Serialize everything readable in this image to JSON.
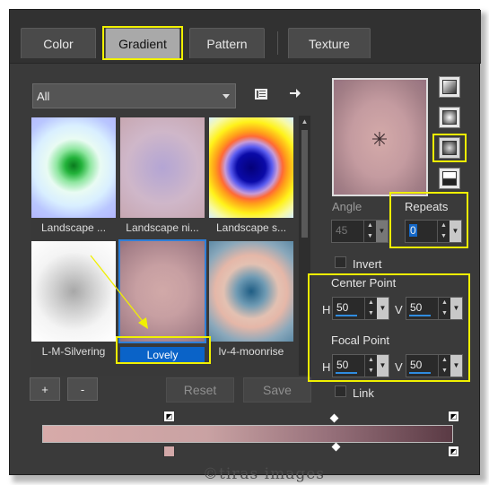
{
  "tabs": [
    {
      "label": "Color"
    },
    {
      "label": "Gradient"
    },
    {
      "label": "Pattern"
    },
    {
      "label": "Texture"
    }
  ],
  "filter": {
    "selected": "All"
  },
  "icons": {
    "browse": "folder-icon",
    "arrow": "arrow-right-icon"
  },
  "gallery": {
    "items": [
      {
        "label": "Landscape ..."
      },
      {
        "label": "Landscape ni..."
      },
      {
        "label": "Landscape s..."
      },
      {
        "label": "L-M-Silvering"
      },
      {
        "label": "Lovely"
      },
      {
        "label": "lv-4-moonrise"
      }
    ]
  },
  "buttons": {
    "add": "+",
    "remove": "-",
    "reset": "Reset",
    "save": "Save"
  },
  "angle": {
    "label": "Angle",
    "value": "45"
  },
  "repeats": {
    "label": "Repeats",
    "value": "0"
  },
  "invert": {
    "label": "Invert"
  },
  "center_point": {
    "title": "Center Point",
    "h_label": "H",
    "h_value": "50",
    "v_label": "V",
    "v_value": "50"
  },
  "focal_point": {
    "title": "Focal Point",
    "h_label": "H",
    "h_value": "50",
    "v_label": "V",
    "v_value": "50"
  },
  "link": {
    "label": "Link"
  },
  "watermark": "©tiras images",
  "colors": {
    "highlight": "#f0f000",
    "selection": "#0a63c8",
    "panel": "#3a3a3a"
  }
}
